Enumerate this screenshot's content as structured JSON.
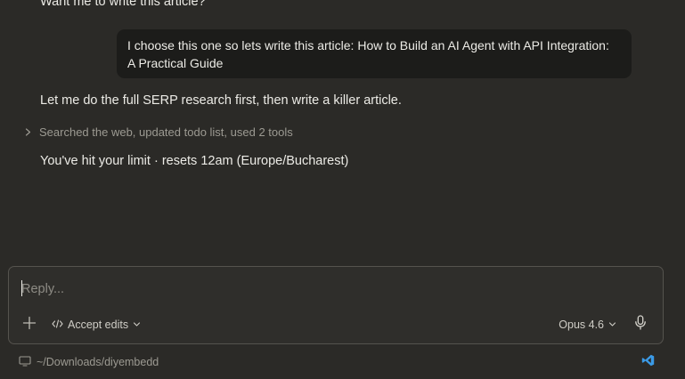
{
  "conversation": {
    "previous_assistant_tail": "Want me to write this article?",
    "user_message": "I choose this one so lets write this article: How to Build an AI Agent with API Integration: A Practical Guide",
    "assistant_message": "Let me do the full SERP research first, then write a killer article.",
    "tool_summary": "Searched the web, updated todo list, used 2 tools",
    "limit_notice": "You've hit your limit · resets 12am (Europe/Bucharest)"
  },
  "composer": {
    "placeholder": "Reply...",
    "value": "",
    "mode_label": "Accept edits",
    "model_label": "Opus 4.6"
  },
  "footer": {
    "path": "~/Downloads/diyembedd"
  },
  "icons": {
    "tool_toggle": "chevron-right-icon",
    "attach": "plus-icon",
    "mode": "code-icon",
    "dropdown": "chevron-down-icon",
    "mic": "microphone-icon",
    "folder": "monitor-icon",
    "editor": "vscode-icon"
  },
  "colors": {
    "background": "#2b2a27",
    "user_bubble": "#1c1c1a",
    "composer_bg": "#2f2e2b",
    "composer_border": "#55534e",
    "muted_text": "#9c9a92",
    "primary_text": "#ecebe6",
    "vscode_blue": "#3b9ae6"
  }
}
